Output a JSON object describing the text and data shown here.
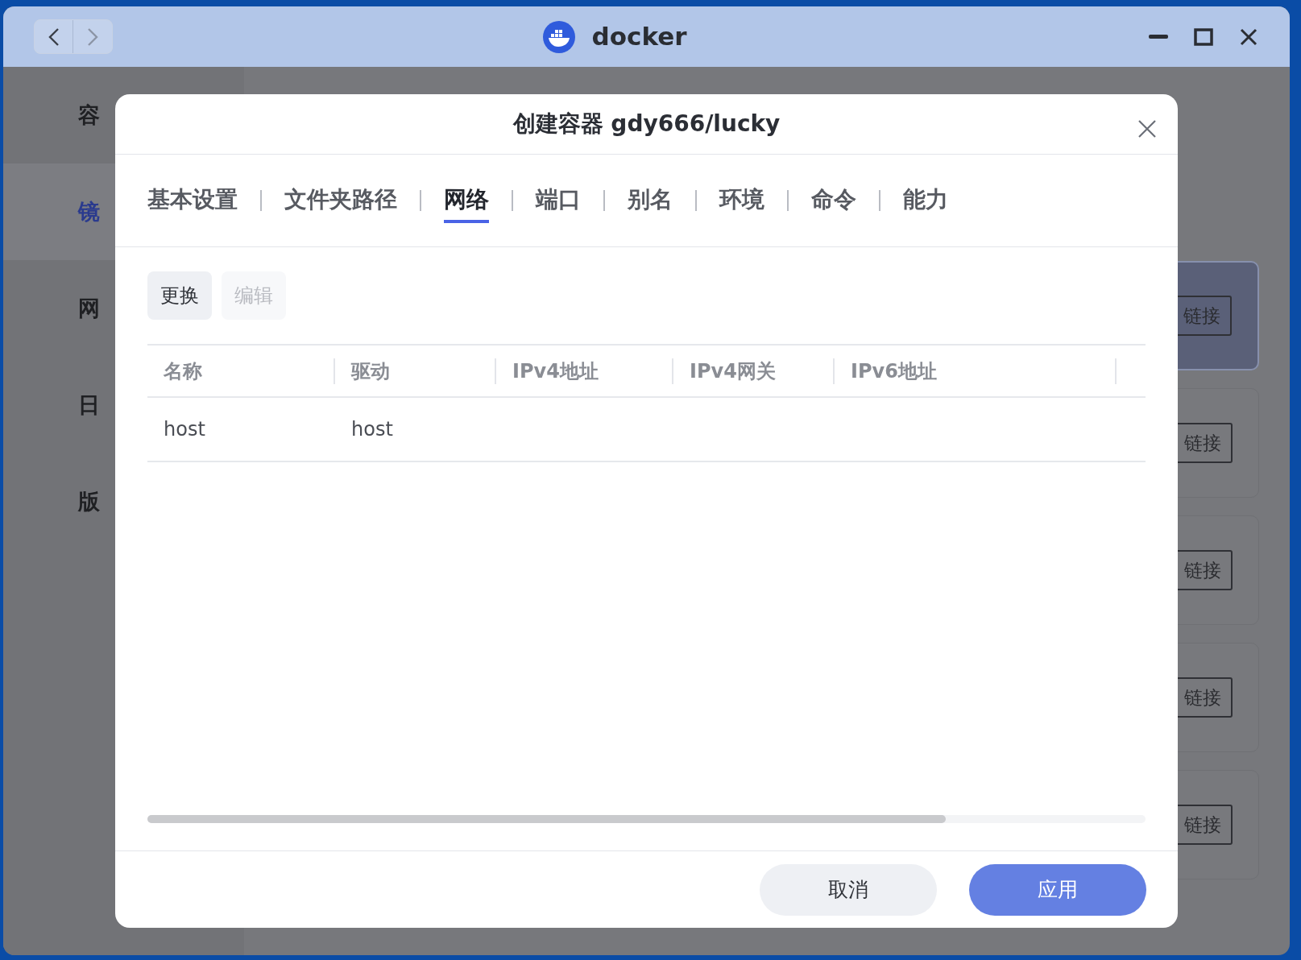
{
  "window": {
    "title": "docker"
  },
  "sidebar": {
    "items": [
      {
        "label": "容",
        "selected": false
      },
      {
        "label": "镜",
        "selected": true
      },
      {
        "label": "网",
        "selected": false
      },
      {
        "label": "日",
        "selected": false
      },
      {
        "label": "版",
        "selected": false
      }
    ]
  },
  "cards": [
    {
      "button": "链接",
      "selected": true
    },
    {
      "button": "链接",
      "selected": false
    },
    {
      "button": "链接",
      "selected": false
    },
    {
      "button": "链接",
      "selected": false
    },
    {
      "button": "链接",
      "selected": false
    }
  ],
  "dialog": {
    "title": "创建容器 gdy666/lucky",
    "tabs": [
      {
        "label": "基本设置",
        "selected": false
      },
      {
        "label": "文件夹路径",
        "selected": false
      },
      {
        "label": "网络",
        "selected": true
      },
      {
        "label": "端口",
        "selected": false
      },
      {
        "label": "别名",
        "selected": false
      },
      {
        "label": "环境",
        "selected": false
      },
      {
        "label": "命令",
        "selected": false
      },
      {
        "label": "能力",
        "selected": false
      }
    ],
    "toolbar": [
      {
        "label": "更换",
        "disabled": false
      },
      {
        "label": "编辑",
        "disabled": true
      }
    ],
    "table": {
      "columns": [
        "名称",
        "驱动",
        "IPv4地址",
        "IPv4网关",
        "IPv6地址"
      ],
      "rows": [
        {
          "cells": [
            "host",
            "host"
          ]
        }
      ]
    },
    "footer": [
      {
        "label": "取消",
        "kind": "secondary"
      },
      {
        "label": "应用",
        "kind": "primary"
      }
    ]
  }
}
